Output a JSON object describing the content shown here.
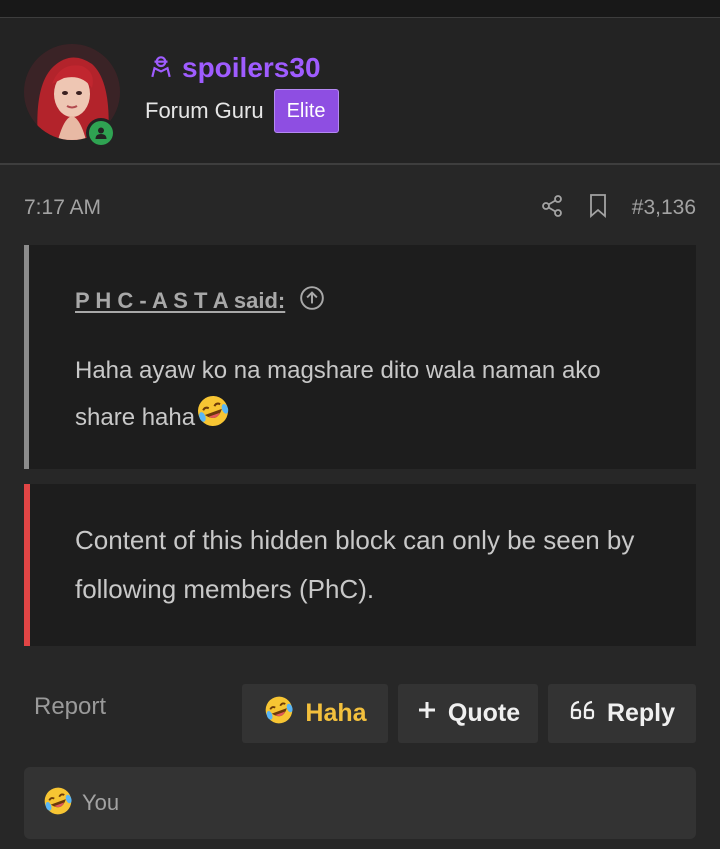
{
  "user": {
    "username": "spoilers30",
    "title": "Forum Guru",
    "badge": "Elite",
    "online": true
  },
  "post": {
    "time": "7:17 AM",
    "number": "#3,136",
    "quote": {
      "author": "P H C - A S T A said:",
      "text": "Haha ayaw ko na magshare dito wala naman ako share haha"
    },
    "hidden_notice": "Content of this hidden block can only be seen by following members (PhC)."
  },
  "actions": {
    "report": "Report",
    "haha": "Haha",
    "quote": "Quote",
    "reply": "Reply"
  },
  "reactions": {
    "text": "You"
  },
  "colors": {
    "username": "#9f5cff",
    "badge": "#8e4ee2",
    "online": "#2fa352",
    "haha": "#f3c03d",
    "hidden_border": "#e14545"
  },
  "icons": [
    "user-icon",
    "share-icon",
    "bookmark-icon",
    "arrow-up-circle-icon",
    "laughing-emoji-icon",
    "plus-icon",
    "quote-marks-icon"
  ]
}
